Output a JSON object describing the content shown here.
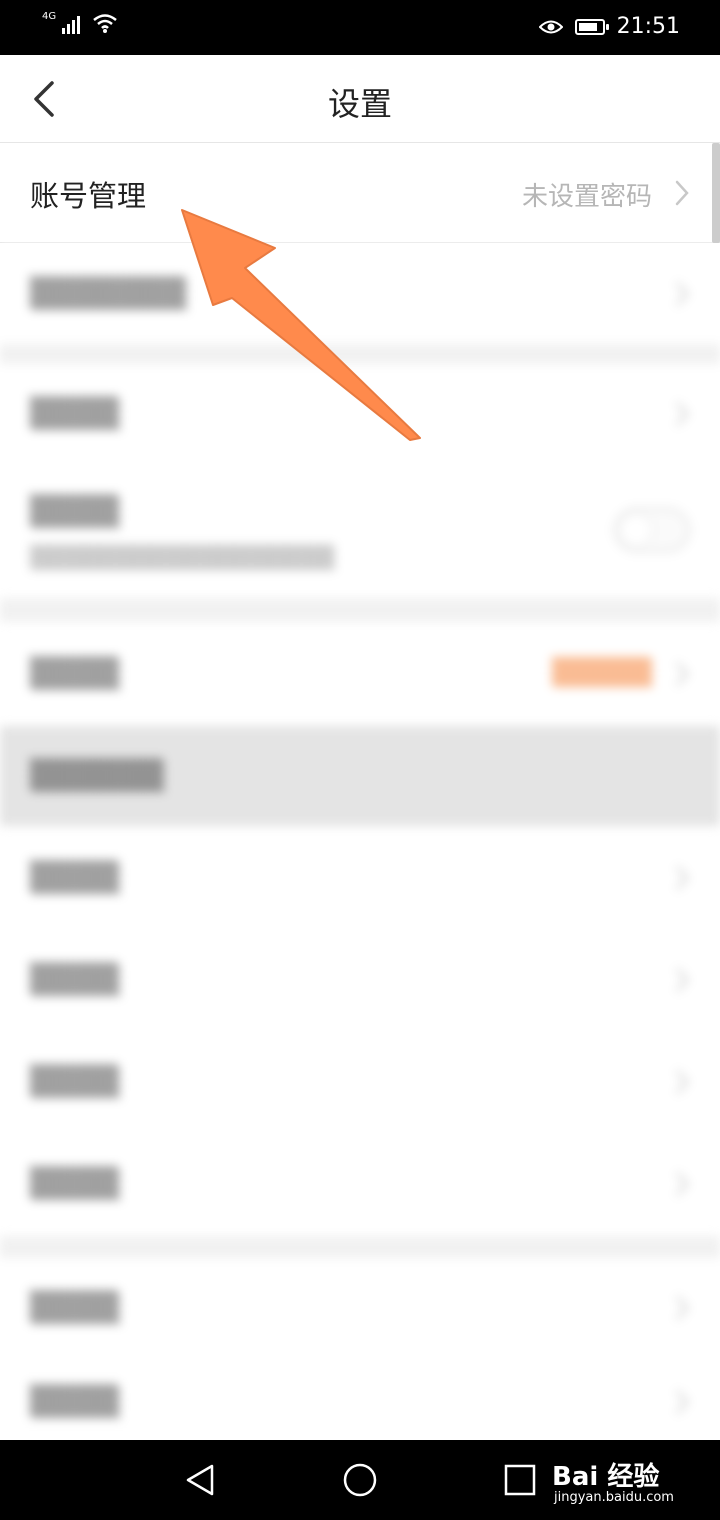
{
  "status_bar": {
    "network": "4G",
    "time": "21:51"
  },
  "header": {
    "title": "设置"
  },
  "account_row": {
    "label": "账号管理",
    "value": "未设置密码"
  },
  "colors": {
    "accent": "#f47a2a",
    "arrow": "#ff8a4c"
  },
  "watermark": {
    "brand": "Bai 经验",
    "url": "jingyan.baidu.com"
  }
}
